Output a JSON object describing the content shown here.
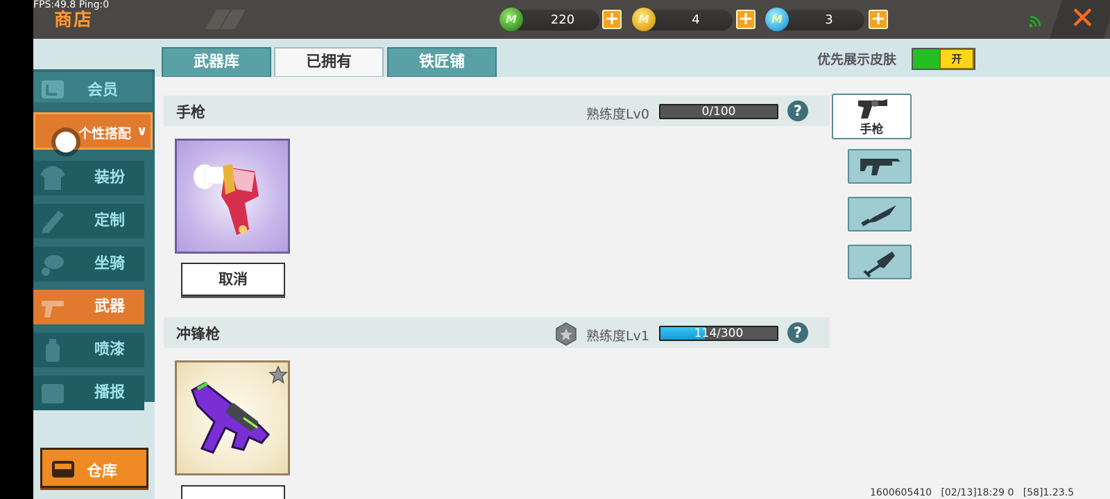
{
  "status": {
    "fps": "FPS:49.8  Ping:0"
  },
  "header": {
    "title": "商店",
    "currencies": [
      {
        "name": "green-gem",
        "value": "220",
        "color": "#3a9a2a"
      },
      {
        "name": "gold-coin",
        "value": "4",
        "color": "#e0a91a"
      },
      {
        "name": "blue-coin",
        "value": "3",
        "color": "#33a9e8"
      }
    ],
    "coin_glyph": "M",
    "plus_glyph": "+",
    "close_glyph": "✕"
  },
  "sidebar": {
    "items": [
      {
        "label": "会员"
      },
      {
        "label": "个性搭配",
        "chevron": "∨"
      },
      {
        "label": "装扮"
      },
      {
        "label": "定制"
      },
      {
        "label": "坐骑"
      },
      {
        "label": "武器",
        "active": true
      },
      {
        "label": "喷漆"
      },
      {
        "label": "播报"
      }
    ],
    "warehouse": "仓库"
  },
  "tabs": [
    {
      "label": "武器库"
    },
    {
      "label": "已拥有",
      "active": true
    },
    {
      "label": "铁匠铺"
    }
  ],
  "skin_toggle": {
    "label": "优先展示皮肤",
    "state": "开",
    "on": true
  },
  "sections": [
    {
      "title": "手枪",
      "proficiency_label": "熟练度Lv0",
      "progress": {
        "current": 0,
        "max": 100,
        "text": "0/100"
      },
      "item_button": "取消"
    },
    {
      "title": "冲锋枪",
      "proficiency_label": "熟练度Lv1",
      "progress": {
        "current": 114,
        "max": 300,
        "text": "114/300"
      }
    }
  ],
  "help_glyph": "?",
  "categories": [
    {
      "name": "pistol",
      "label": "手枪",
      "selected": true
    },
    {
      "name": "smg"
    },
    {
      "name": "knife"
    },
    {
      "name": "shovel"
    }
  ],
  "footer": {
    "uid": "1600605410",
    "time": "[02/13]18:29 0",
    "version": "[58]1.23.5"
  }
}
